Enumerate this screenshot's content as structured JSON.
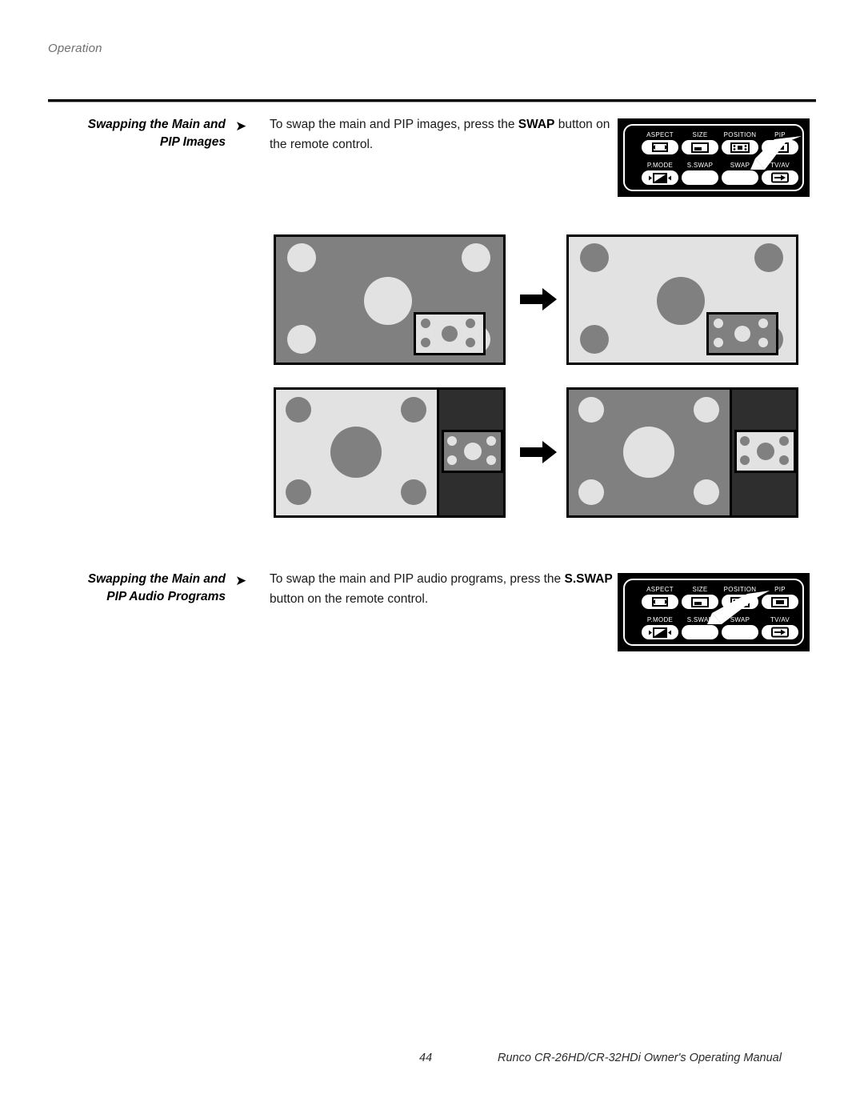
{
  "header": {
    "running_head": "Operation"
  },
  "sections": [
    {
      "title_line1": "Swapping the Main and",
      "title_line2": "PIP Images",
      "bullet": "➤",
      "body_pre": "To swap the main and PIP images, press the ",
      "body_bold": "SWAP",
      "body_post": " button on the remote control.",
      "highlight_button": "SWAP"
    },
    {
      "title_line1": "Swapping the Main and",
      "title_line2": "PIP Audio Programs",
      "bullet": "➤",
      "body_pre": "To swap the main and PIP audio programs, press the ",
      "body_bold": "S.SWAP",
      "body_post": " button on the remote control.",
      "highlight_button": "S.SWAP"
    }
  ],
  "remote": {
    "row1": [
      {
        "label": "ASPECT",
        "icon": "aspect-icon"
      },
      {
        "label": "SIZE",
        "icon": "size-icon"
      },
      {
        "label": "POSITION",
        "icon": "position-icon"
      },
      {
        "label": "PIP",
        "icon": "pip-icon"
      }
    ],
    "row2": [
      {
        "label": "P.MODE",
        "icon": "picture-mode-icon"
      },
      {
        "label": "S.SWAP",
        "icon": "blank-icon"
      },
      {
        "label": "SWAP",
        "icon": "blank-icon"
      },
      {
        "label": "TV/AV",
        "icon": "input-select-icon"
      }
    ]
  },
  "diagrams": {
    "flow_arrow": "→",
    "row_pip": {
      "before": {
        "layout": "pip-overlay",
        "main_fill": "#808080",
        "main_dot_fill": "#e2e2e2",
        "pip_fill": "#e2e2e2",
        "pip_dot_fill": "#808080"
      },
      "after": {
        "layout": "pip-overlay",
        "main_fill": "#e2e2e2",
        "main_dot_fill": "#808080",
        "pip_fill": "#808080",
        "pip_dot_fill": "#e2e2e2"
      }
    },
    "row_pop": {
      "before": {
        "layout": "side-by-side",
        "main_fill": "#e2e2e2",
        "main_dot_fill": "#808080",
        "pip_fill": "#808080",
        "pip_dot_fill": "#e2e2e2",
        "bar_fill": "#2e2e2e"
      },
      "after": {
        "layout": "side-by-side",
        "main_fill": "#808080",
        "main_dot_fill": "#e2e2e2",
        "pip_fill": "#e2e2e2",
        "pip_dot_fill": "#808080",
        "bar_fill": "#2e2e2e"
      }
    }
  },
  "footer": {
    "page_number": "44",
    "manual_title": "Runco CR-26HD/CR-32HDi Owner's Operating Manual"
  }
}
